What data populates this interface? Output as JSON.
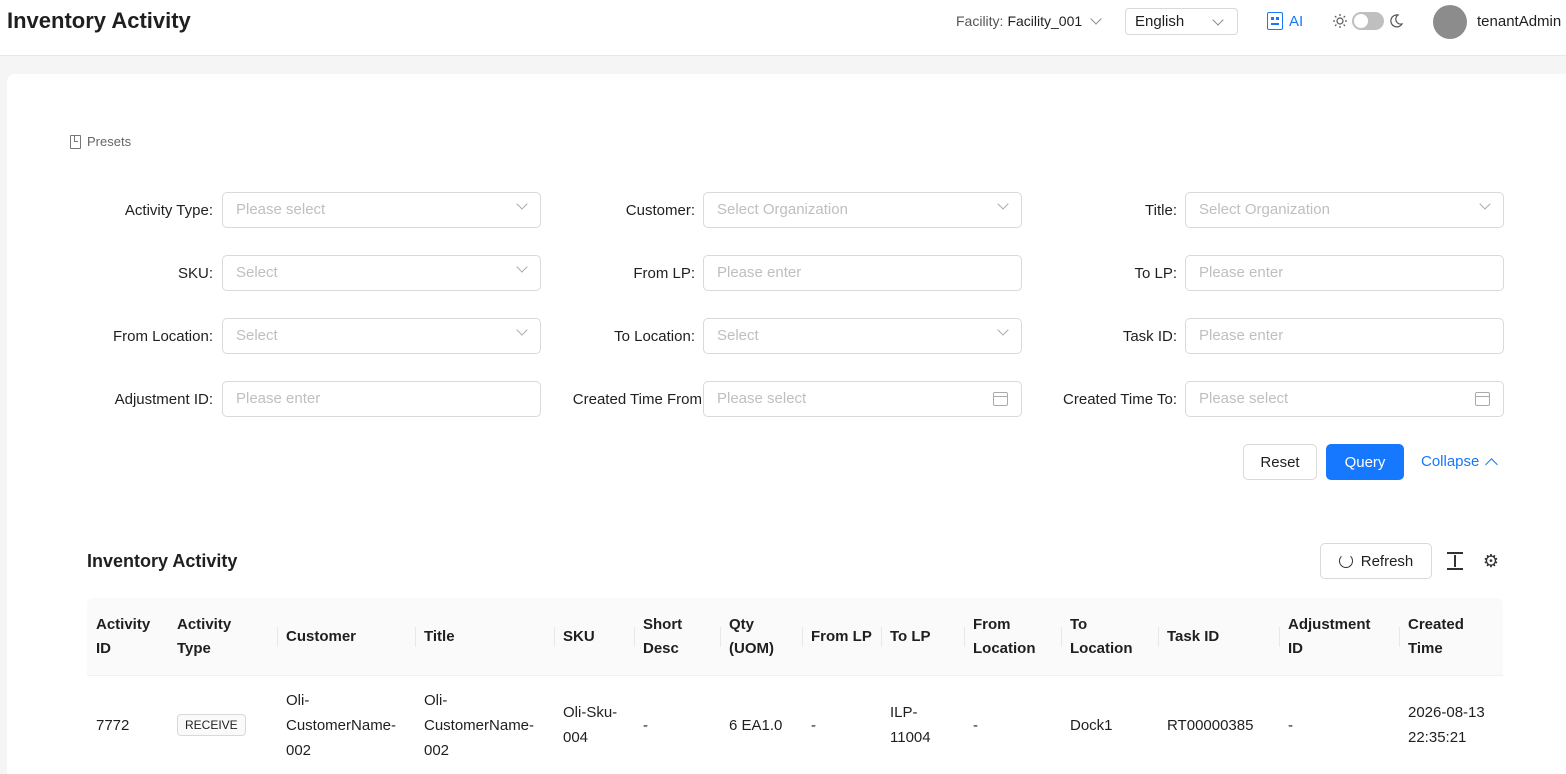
{
  "header": {
    "title": "Inventory Activity",
    "facility_label": "Facility:",
    "facility_value": "Facility_001",
    "language": "English",
    "ai_label": "AI",
    "username": "tenantAdmin"
  },
  "presets_label": "Presets",
  "filters": {
    "activity_type": {
      "label": "Activity Type",
      "placeholder": "Please select"
    },
    "customer": {
      "label": "Customer",
      "placeholder": "Select Organization"
    },
    "title": {
      "label": "Title",
      "placeholder": "Select Organization"
    },
    "sku": {
      "label": "SKU",
      "placeholder": "Select"
    },
    "from_lp": {
      "label": "From LP",
      "placeholder": "Please enter"
    },
    "to_lp": {
      "label": "To LP",
      "placeholder": "Please enter"
    },
    "from_location": {
      "label": "From Location",
      "placeholder": "Select"
    },
    "to_location": {
      "label": "To Location",
      "placeholder": "Select"
    },
    "task_id": {
      "label": "Task ID",
      "placeholder": "Please enter"
    },
    "adjustment_id": {
      "label": "Adjustment ID",
      "placeholder": "Please enter"
    },
    "created_from": {
      "label": "Created Time From",
      "placeholder": "Please select"
    },
    "created_to": {
      "label": "Created Time To",
      "placeholder": "Please select"
    }
  },
  "actions": {
    "reset": "Reset",
    "query": "Query",
    "collapse": "Collapse"
  },
  "table": {
    "title": "Inventory Activity",
    "refresh": "Refresh",
    "columns": [
      {
        "l1": "Activity",
        "l2": "ID"
      },
      {
        "l1": "Activity",
        "l2": "Type"
      },
      {
        "l1": "Customer",
        "l2": ""
      },
      {
        "l1": "Title",
        "l2": ""
      },
      {
        "l1": "SKU",
        "l2": ""
      },
      {
        "l1": "Short",
        "l2": "Desc"
      },
      {
        "l1": "Qty",
        "l2": "(UOM)"
      },
      {
        "l1": "From LP",
        "l2": ""
      },
      {
        "l1": "To LP",
        "l2": ""
      },
      {
        "l1": "From",
        "l2": "Location"
      },
      {
        "l1": "To",
        "l2": "Location"
      },
      {
        "l1": "Task ID",
        "l2": ""
      },
      {
        "l1": "Adjustment",
        "l2": "ID"
      },
      {
        "l1": "Created",
        "l2": "Time"
      }
    ],
    "rows": [
      {
        "activity_id": "7772",
        "activity_type": "RECEIVE",
        "customer": [
          "Oli-",
          "CustomerName-",
          "002"
        ],
        "title": [
          "Oli-",
          "CustomerName-",
          "002"
        ],
        "sku": [
          "Oli-Sku-",
          "004"
        ],
        "short_desc": "-",
        "qty": "6 EA1.0",
        "from_lp": "-",
        "to_lp": [
          "ILP-",
          "11004"
        ],
        "from_location": "-",
        "to_location": "Dock1",
        "task_id": "RT00000385",
        "adjustment_id": "-",
        "created_time": [
          "2026-08-13",
          "22:35:21"
        ]
      }
    ]
  }
}
